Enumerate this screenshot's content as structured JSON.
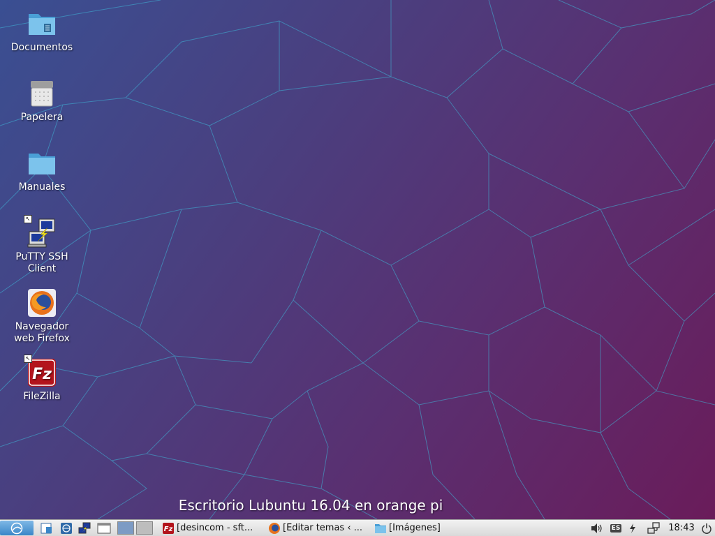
{
  "desktop": {
    "icons": [
      {
        "label": "Documentos",
        "icon": "folder-documents-icon"
      },
      {
        "label": "Papelera",
        "icon": "trash-icon"
      },
      {
        "label": "Manuales",
        "icon": "folder-icon"
      },
      {
        "label": "PuTTY SSH Client",
        "icon": "putty-icon",
        "shortcut": true
      },
      {
        "label": "Navegador web Firefox",
        "icon": "firefox-icon"
      },
      {
        "label": "FileZilla",
        "icon": "filezilla-icon",
        "shortcut": true
      }
    ],
    "caption": "Escritorio Lubuntu 16.04 en orange pi"
  },
  "taskbar": {
    "tasks": [
      {
        "label": "[desincom - sft...",
        "icon": "filezilla-icon"
      },
      {
        "label": "[Editar temas ‹ ...",
        "icon": "firefox-icon"
      },
      {
        "label": "[Imágenes]",
        "icon": "folder-icon"
      }
    ],
    "keyboard_layout": "ES",
    "clock": "18:43"
  },
  "colors": {
    "accent": "#3a86c8",
    "wallpaper_lines": "#3fb6d8"
  }
}
